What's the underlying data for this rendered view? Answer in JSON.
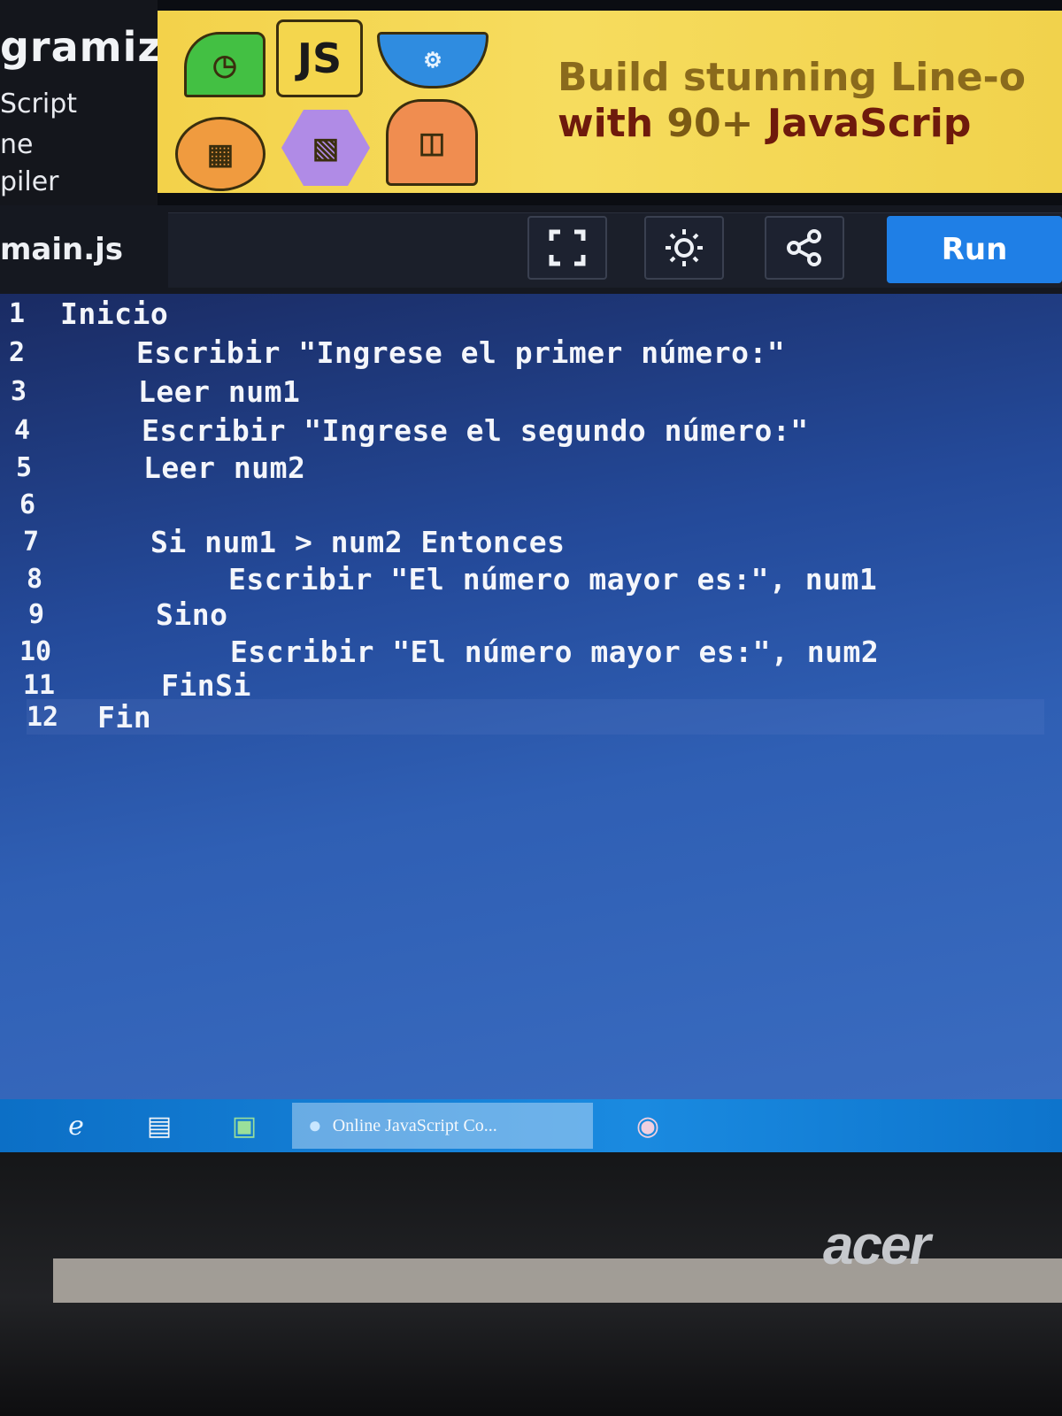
{
  "sidebar": {
    "brand": "gramiz",
    "lines": [
      "Script",
      "ne",
      "piler"
    ]
  },
  "ad": {
    "headline": "Build stunning Line-o",
    "subline_prefix": "with ",
    "subline_number": "90+",
    "subline_suffix": " JavaScrip",
    "tiles": [
      "timer-icon",
      "JS",
      "filter-icon",
      "table-icon",
      "chart-icon",
      "grid-icon"
    ]
  },
  "toolbar": {
    "file_tab": "main.js",
    "run_label": "Run",
    "icons": [
      "fullscreen-icon",
      "theme-icon",
      "share-icon"
    ]
  },
  "editor": {
    "lines": [
      {
        "n": "1",
        "text": "Inicio"
      },
      {
        "n": "2",
        "text": "Escribir \"Ingrese el primer número:\""
      },
      {
        "n": "3",
        "text": "Leer num1"
      },
      {
        "n": "4",
        "text": "Escribir \"Ingrese el segundo número:\""
      },
      {
        "n": "5",
        "text": "Leer num2"
      },
      {
        "n": "6",
        "text": ""
      },
      {
        "n": "7",
        "text": "Si num1 > num2 Entonces"
      },
      {
        "n": "8",
        "text": "Escribir \"El número mayor es:\", num1"
      },
      {
        "n": "9",
        "text": "Sino"
      },
      {
        "n": "10",
        "text": "Escribir \"El número mayor es:\", num2"
      },
      {
        "n": "11",
        "text": "FinSi"
      },
      {
        "n": "12",
        "text": "Fin"
      }
    ]
  },
  "taskbar": {
    "active_app": "Online JavaScript Co..."
  },
  "device": {
    "brand": "acer"
  }
}
